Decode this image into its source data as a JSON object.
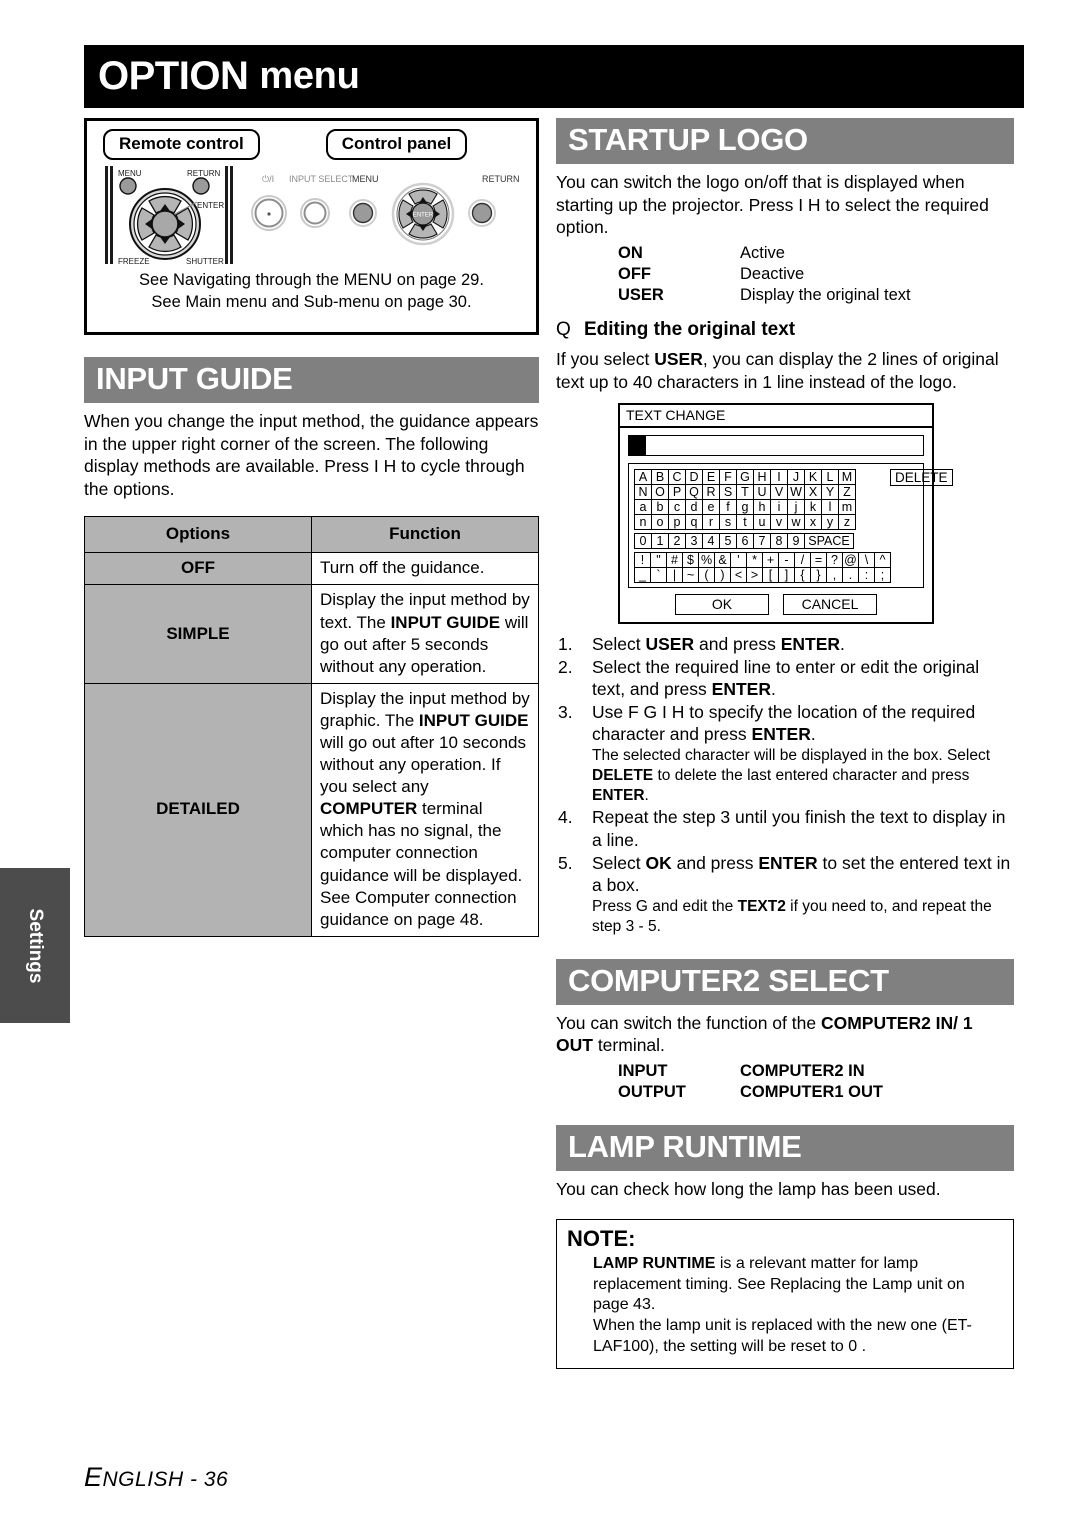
{
  "page": {
    "title_word1": "OPTION",
    "title_word2": "menu",
    "side_tab": "Settings",
    "footer_e": "E",
    "footer_rest": "NGLISH - 36"
  },
  "figure": {
    "remote_label": "Remote control",
    "panel_label": "Control panel",
    "remote_buttons": {
      "menu": "MENU",
      "return": "RETURN",
      "enter": "ENTER",
      "freeze": "FREEZE",
      "shutter": "SHUTTER"
    },
    "panel_buttons": {
      "power": "⏻/I",
      "input_select": "INPUT SELECT",
      "menu": "MENU",
      "return": "RETURN",
      "enter": "ENTER"
    },
    "caption_line1": "See  Navigating through the MENU  on page 29.",
    "caption_line2": "See  Main menu and Sub-menu  on page 30."
  },
  "input_guide": {
    "heading": "INPUT GUIDE",
    "intro": "When you change the input method, the guidance appears in the upper right corner of the screen. The following display methods are available. Press I  H  to cycle through the options.",
    "table": {
      "headers": [
        "Options",
        "Function"
      ],
      "rows": [
        {
          "option": "OFF",
          "function_parts": [
            {
              "t": "Turn off the guidance.",
              "bold": false
            }
          ]
        },
        {
          "option": "SIMPLE",
          "function_parts": [
            {
              "t": "Display the input method by text. The ",
              "bold": false
            },
            {
              "t": "INPUT GUIDE",
              "bold": true
            },
            {
              "t": " will go out after 5 seconds without any operation.",
              "bold": false
            }
          ]
        },
        {
          "option": "DETAILED",
          "function_parts": [
            {
              "t": "Display the input method by graphic. The ",
              "bold": false
            },
            {
              "t": "INPUT GUIDE",
              "bold": true
            },
            {
              "t": " will go out after 10 seconds without any operation. If you select any ",
              "bold": false
            },
            {
              "t": "COMPUTER",
              "bold": true
            },
            {
              "t": " terminal which has no signal, the computer connection guidance will be displayed. See  Computer connection guidance  on page 48.",
              "bold": false
            }
          ]
        }
      ]
    }
  },
  "startup_logo": {
    "heading": "STARTUP LOGO",
    "intro": "You can switch the logo on/off that is displayed when starting up the projector. Press I  H  to select the required option.",
    "options": [
      {
        "key": "ON",
        "value": "Active"
      },
      {
        "key": "OFF",
        "value": "Deactive"
      },
      {
        "key": "USER",
        "value": "Display the original text"
      }
    ],
    "subheading_marker": "Q",
    "subheading": "Editing the original text",
    "sub_intro_parts": [
      {
        "t": "If you select ",
        "bold": false
      },
      {
        "t": "USER",
        "bold": true
      },
      {
        "t": ", you can display the 2 lines of original text up to 40 characters in 1 line instead of the logo.",
        "bold": false
      }
    ],
    "text_change_dialog": {
      "title": "TEXT CHANGE",
      "rows": [
        [
          "A",
          "B",
          "C",
          "D",
          "E",
          "F",
          "G",
          "H",
          "I",
          "J",
          "K",
          "L",
          "M"
        ],
        [
          "N",
          "O",
          "P",
          "Q",
          "R",
          "S",
          "T",
          "U",
          "V",
          "W",
          "X",
          "Y",
          "Z"
        ],
        [
          "a",
          "b",
          "c",
          "d",
          "e",
          "f",
          "g",
          "h",
          "i",
          "j",
          "k",
          "l",
          "m"
        ],
        [
          "n",
          "o",
          "p",
          "q",
          "r",
          "s",
          "t",
          "u",
          "v",
          "w",
          "x",
          "y",
          "z"
        ]
      ],
      "number_row": [
        "0",
        "1",
        "2",
        "3",
        "4",
        "5",
        "6",
        "7",
        "8",
        "9"
      ],
      "space_key": "SPACE",
      "symbol_row1": [
        "!",
        "\"",
        "#",
        "$",
        "%",
        "&",
        "'",
        "*",
        "+",
        "-",
        "/",
        "=",
        "?",
        "@",
        "\\",
        "^"
      ],
      "symbol_row2": [
        "_",
        "`",
        "|",
        "~",
        "(",
        ")",
        "<",
        ">",
        "[",
        "]",
        "{",
        "}",
        ",",
        ".",
        ":",
        ";"
      ],
      "delete_key": "DELETE",
      "ok_button": "OK",
      "cancel_button": "CANCEL"
    },
    "steps": [
      {
        "num": "1.",
        "parts": [
          {
            "t": "Select ",
            "bold": false
          },
          {
            "t": "USER",
            "bold": true
          },
          {
            "t": " and press ",
            "bold": false
          },
          {
            "t": "ENTER",
            "bold": true
          },
          {
            "t": ".",
            "bold": false
          }
        ],
        "sub": []
      },
      {
        "num": "2.",
        "parts": [
          {
            "t": "Select the required line to enter or edit the original text, and press ",
            "bold": false
          },
          {
            "t": "ENTER",
            "bold": true
          },
          {
            "t": ".",
            "bold": false
          }
        ],
        "sub": []
      },
      {
        "num": "3.",
        "parts": [
          {
            "t": "Use F  G  I   H  to specify the location of the required character and press ",
            "bold": false
          },
          {
            "t": "ENTER",
            "bold": true
          },
          {
            "t": ".",
            "bold": false
          }
        ],
        "sub": [
          {
            "t": "The selected character will be displayed in the box. Select ",
            "bold": false
          },
          {
            "t": "DELETE",
            "bold": true
          },
          {
            "t": " to delete the last entered character and press ",
            "bold": false
          },
          {
            "t": "ENTER",
            "bold": true
          },
          {
            "t": ".",
            "bold": false
          }
        ]
      },
      {
        "num": "4.",
        "parts": [
          {
            "t": "Repeat the step 3 until you finish the text to display in a line.",
            "bold": false
          }
        ],
        "sub": []
      },
      {
        "num": "5.",
        "parts": [
          {
            "t": "Select ",
            "bold": false
          },
          {
            "t": "OK",
            "bold": true
          },
          {
            "t": " and press ",
            "bold": false
          },
          {
            "t": "ENTER",
            "bold": true
          },
          {
            "t": " to set the entered text in a box.",
            "bold": false
          }
        ],
        "sub": [
          {
            "t": "Press G  and edit the ",
            "bold": false
          },
          {
            "t": "TEXT2",
            "bold": true
          },
          {
            "t": " if you need to, and repeat the step 3 - 5.",
            "bold": false
          }
        ]
      }
    ]
  },
  "computer2_select": {
    "heading": "COMPUTER2 SELECT",
    "intro_parts": [
      {
        "t": "You can switch the function of the ",
        "bold": false
      },
      {
        "t": "COMPUTER2 IN/ 1 OUT",
        "bold": true
      },
      {
        "t": " terminal.",
        "bold": false
      }
    ],
    "options": [
      {
        "key": "INPUT",
        "value": "COMPUTER2 IN"
      },
      {
        "key": "OUTPUT",
        "value": "COMPUTER1 OUT"
      }
    ]
  },
  "lamp_runtime": {
    "heading": "LAMP RUNTIME",
    "intro": "You can check how long the lamp has been used.",
    "note": {
      "title": "NOTE:",
      "paragraphs": [
        [
          {
            "t": "LAMP RUNTIME",
            "bold": true
          },
          {
            "t": " is a relevant matter for lamp replacement timing. See  Replacing the Lamp unit  on page 43.",
            "bold": false
          }
        ],
        [
          {
            "t": "When the lamp unit is replaced with the new one (ET-LAF100), the setting will be reset to  0 .",
            "bold": false
          }
        ]
      ]
    }
  },
  "colors": {
    "banner": "#000000",
    "section_header": "#808080",
    "table_header": "#b3b3b3",
    "side_tab": "#4c4c4c"
  }
}
